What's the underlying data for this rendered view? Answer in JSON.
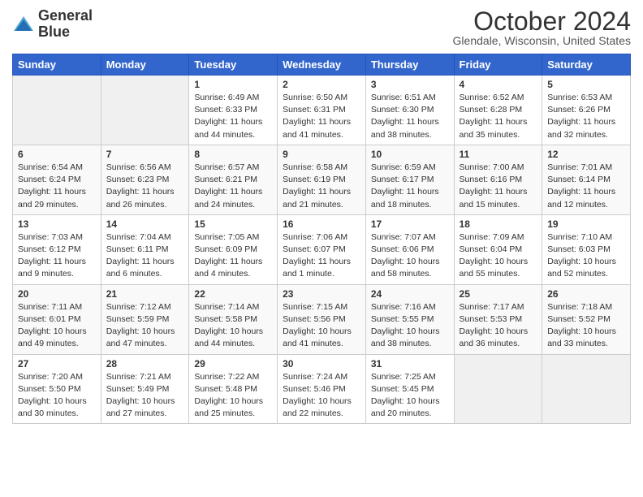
{
  "header": {
    "logo_line1": "General",
    "logo_line2": "Blue",
    "month": "October 2024",
    "location": "Glendale, Wisconsin, United States"
  },
  "weekdays": [
    "Sunday",
    "Monday",
    "Tuesday",
    "Wednesday",
    "Thursday",
    "Friday",
    "Saturday"
  ],
  "weeks": [
    [
      {
        "day": "",
        "content": ""
      },
      {
        "day": "",
        "content": ""
      },
      {
        "day": "1",
        "content": "Sunrise: 6:49 AM\nSunset: 6:33 PM\nDaylight: 11 hours and 44 minutes."
      },
      {
        "day": "2",
        "content": "Sunrise: 6:50 AM\nSunset: 6:31 PM\nDaylight: 11 hours and 41 minutes."
      },
      {
        "day": "3",
        "content": "Sunrise: 6:51 AM\nSunset: 6:30 PM\nDaylight: 11 hours and 38 minutes."
      },
      {
        "day": "4",
        "content": "Sunrise: 6:52 AM\nSunset: 6:28 PM\nDaylight: 11 hours and 35 minutes."
      },
      {
        "day": "5",
        "content": "Sunrise: 6:53 AM\nSunset: 6:26 PM\nDaylight: 11 hours and 32 minutes."
      }
    ],
    [
      {
        "day": "6",
        "content": "Sunrise: 6:54 AM\nSunset: 6:24 PM\nDaylight: 11 hours and 29 minutes."
      },
      {
        "day": "7",
        "content": "Sunrise: 6:56 AM\nSunset: 6:23 PM\nDaylight: 11 hours and 26 minutes."
      },
      {
        "day": "8",
        "content": "Sunrise: 6:57 AM\nSunset: 6:21 PM\nDaylight: 11 hours and 24 minutes."
      },
      {
        "day": "9",
        "content": "Sunrise: 6:58 AM\nSunset: 6:19 PM\nDaylight: 11 hours and 21 minutes."
      },
      {
        "day": "10",
        "content": "Sunrise: 6:59 AM\nSunset: 6:17 PM\nDaylight: 11 hours and 18 minutes."
      },
      {
        "day": "11",
        "content": "Sunrise: 7:00 AM\nSunset: 6:16 PM\nDaylight: 11 hours and 15 minutes."
      },
      {
        "day": "12",
        "content": "Sunrise: 7:01 AM\nSunset: 6:14 PM\nDaylight: 11 hours and 12 minutes."
      }
    ],
    [
      {
        "day": "13",
        "content": "Sunrise: 7:03 AM\nSunset: 6:12 PM\nDaylight: 11 hours and 9 minutes."
      },
      {
        "day": "14",
        "content": "Sunrise: 7:04 AM\nSunset: 6:11 PM\nDaylight: 11 hours and 6 minutes."
      },
      {
        "day": "15",
        "content": "Sunrise: 7:05 AM\nSunset: 6:09 PM\nDaylight: 11 hours and 4 minutes."
      },
      {
        "day": "16",
        "content": "Sunrise: 7:06 AM\nSunset: 6:07 PM\nDaylight: 11 hours and 1 minute."
      },
      {
        "day": "17",
        "content": "Sunrise: 7:07 AM\nSunset: 6:06 PM\nDaylight: 10 hours and 58 minutes."
      },
      {
        "day": "18",
        "content": "Sunrise: 7:09 AM\nSunset: 6:04 PM\nDaylight: 10 hours and 55 minutes."
      },
      {
        "day": "19",
        "content": "Sunrise: 7:10 AM\nSunset: 6:03 PM\nDaylight: 10 hours and 52 minutes."
      }
    ],
    [
      {
        "day": "20",
        "content": "Sunrise: 7:11 AM\nSunset: 6:01 PM\nDaylight: 10 hours and 49 minutes."
      },
      {
        "day": "21",
        "content": "Sunrise: 7:12 AM\nSunset: 5:59 PM\nDaylight: 10 hours and 47 minutes."
      },
      {
        "day": "22",
        "content": "Sunrise: 7:14 AM\nSunset: 5:58 PM\nDaylight: 10 hours and 44 minutes."
      },
      {
        "day": "23",
        "content": "Sunrise: 7:15 AM\nSunset: 5:56 PM\nDaylight: 10 hours and 41 minutes."
      },
      {
        "day": "24",
        "content": "Sunrise: 7:16 AM\nSunset: 5:55 PM\nDaylight: 10 hours and 38 minutes."
      },
      {
        "day": "25",
        "content": "Sunrise: 7:17 AM\nSunset: 5:53 PM\nDaylight: 10 hours and 36 minutes."
      },
      {
        "day": "26",
        "content": "Sunrise: 7:18 AM\nSunset: 5:52 PM\nDaylight: 10 hours and 33 minutes."
      }
    ],
    [
      {
        "day": "27",
        "content": "Sunrise: 7:20 AM\nSunset: 5:50 PM\nDaylight: 10 hours and 30 minutes."
      },
      {
        "day": "28",
        "content": "Sunrise: 7:21 AM\nSunset: 5:49 PM\nDaylight: 10 hours and 27 minutes."
      },
      {
        "day": "29",
        "content": "Sunrise: 7:22 AM\nSunset: 5:48 PM\nDaylight: 10 hours and 25 minutes."
      },
      {
        "day": "30",
        "content": "Sunrise: 7:24 AM\nSunset: 5:46 PM\nDaylight: 10 hours and 22 minutes."
      },
      {
        "day": "31",
        "content": "Sunrise: 7:25 AM\nSunset: 5:45 PM\nDaylight: 10 hours and 20 minutes."
      },
      {
        "day": "",
        "content": ""
      },
      {
        "day": "",
        "content": ""
      }
    ]
  ]
}
